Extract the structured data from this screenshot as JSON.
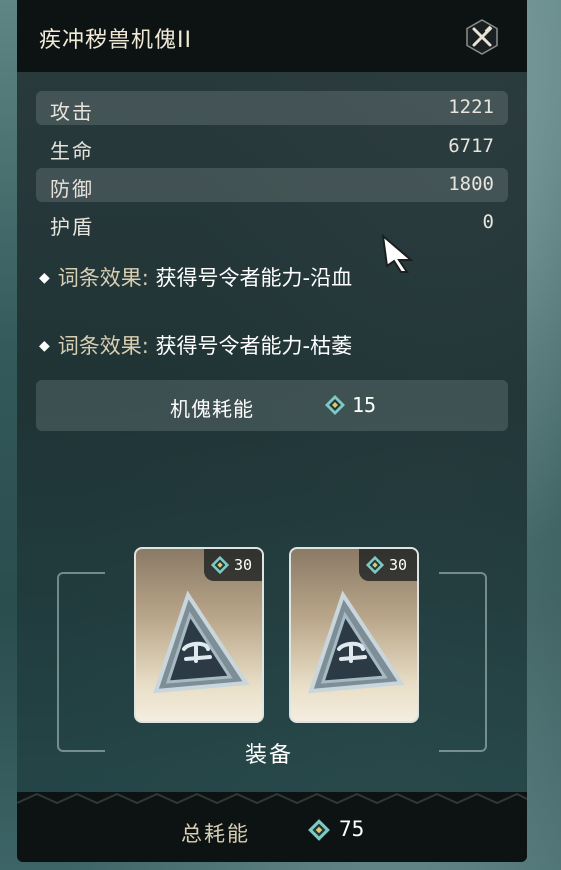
{
  "panel": {
    "title": "疾冲秽兽机傀II",
    "close_icon": "crossed-sword-close-icon"
  },
  "stats": [
    {
      "label": "攻击",
      "value": "1221"
    },
    {
      "label": "生命",
      "value": "6717"
    },
    {
      "label": "防御",
      "value": "1800"
    },
    {
      "label": "护盾",
      "value": "0"
    }
  ],
  "effects": [
    {
      "key": "词条效果:",
      "text": "获得号令者能力-沿血"
    },
    {
      "key": "词条效果:",
      "text": "获得号令者能力-枯萎"
    }
  ],
  "puppet_cost": {
    "label": "机傀耗能",
    "value": "15",
    "icon": "energy-gem-icon"
  },
  "equipment": {
    "label": "装备",
    "cards": [
      {
        "cost": "30",
        "icon": "energy-gem-icon",
        "art": "triangle-rune-item"
      },
      {
        "cost": "30",
        "icon": "energy-gem-icon",
        "art": "triangle-rune-item"
      }
    ]
  },
  "footer": {
    "label": "总耗能",
    "value": "75",
    "icon": "energy-gem-icon"
  },
  "colors": {
    "title_bar": "#0d1213",
    "accent_gold": "#d8cfb3",
    "gem_teal": "#7fc9c3",
    "gem_gold": "#e2c46b"
  }
}
